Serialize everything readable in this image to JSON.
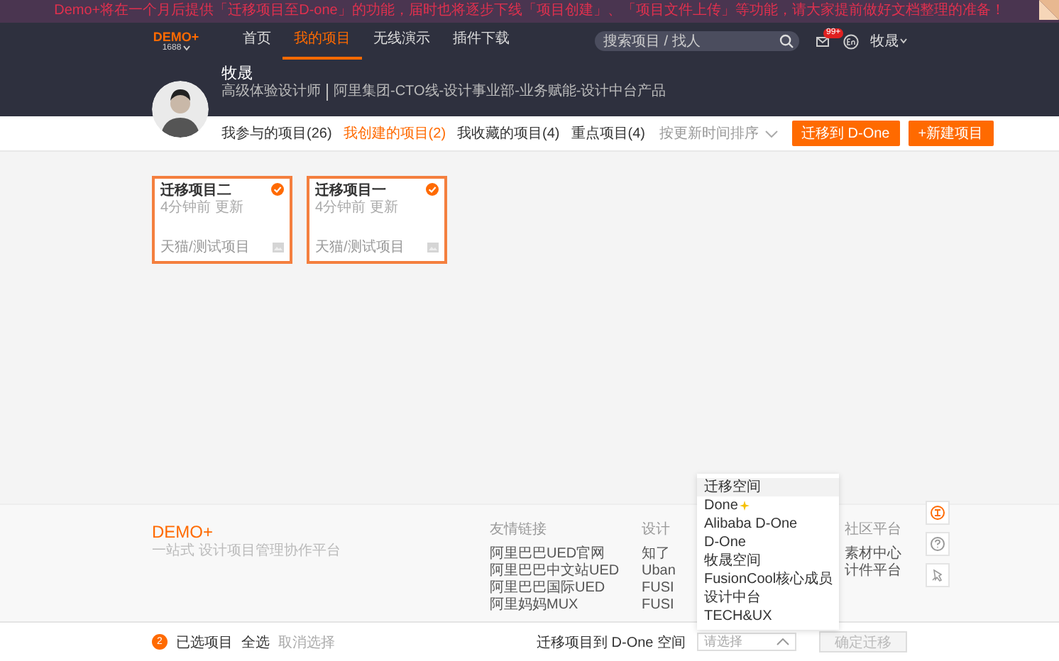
{
  "banner": {
    "text": "Demo+将在一个月后提供「迁移项目至D-one」的功能，届时也将逐步下线「项目创建」、「项目文件上传」等功能，请大家提前做好文档整理的准备！"
  },
  "header": {
    "logo": "DEMO+",
    "org": "1688",
    "nav": [
      {
        "label": "首页",
        "selected": false
      },
      {
        "label": "我的项目",
        "selected": true
      },
      {
        "label": "无线演示",
        "selected": false
      },
      {
        "label": "插件下载",
        "selected": false
      }
    ],
    "search": {
      "placeholder": "搜索项目 / 找人"
    },
    "mail_badge": "99+",
    "user": "牧晟"
  },
  "profile": {
    "name": "牧晟",
    "title": "高级体验设计师",
    "department": "阿里集团-CTO线-设计事业部-业务赋能-设计中台产品"
  },
  "tabs": [
    {
      "label": "我参与的项目(26)",
      "selected": false
    },
    {
      "label": "我创建的项目(2)",
      "selected": true
    },
    {
      "label": "我收藏的项目(4)",
      "selected": false
    },
    {
      "label": "重点项目(4)",
      "selected": false
    }
  ],
  "sort": "按更新时间排序",
  "buttons": [
    {
      "label": "迁移到 D-One"
    },
    {
      "label": "+新建项目"
    }
  ],
  "projects": [
    {
      "title": "迁移项目二",
      "updated": "4分钟前 更新",
      "path": "天猫/测试项目",
      "selected": true
    },
    {
      "title": "迁移项目一",
      "updated": "4分钟前 更新",
      "path": "天猫/测试项目",
      "selected": true
    }
  ],
  "footer": {
    "logo": "DEMO+",
    "slogan": "一站式 设计项目管理协作平台",
    "columns": [
      {
        "title": "友情链接",
        "links": [
          "阿里巴巴UED官网",
          "阿里巴巴中文站UED",
          "阿里巴巴国际UED",
          "阿里妈妈MUX"
        ]
      },
      {
        "title": "设计",
        "links": [
          "知了",
          "Uban",
          "FUSI",
          "FUSI"
        ]
      },
      {
        "title": "社区平台",
        "links": [
          "素材中心",
          "计件平台"
        ]
      }
    ]
  },
  "dropdown": {
    "items": [
      {
        "label": "迁移空间",
        "kind": "plain",
        "selected": true
      },
      {
        "label": "Done",
        "kind": "new",
        "selected": false
      },
      {
        "label": "Alibaba D-One",
        "kind": "plain",
        "selected": false
      },
      {
        "label": "D-One",
        "kind": "plain",
        "selected": false
      },
      {
        "label": "牧晟空间",
        "kind": "plain",
        "selected": false
      },
      {
        "label": "FusionCool核心成员",
        "kind": "plain",
        "selected": false
      },
      {
        "label": "设计中台",
        "kind": "plain",
        "selected": false
      },
      {
        "label": "TECH&UX",
        "kind": "plain",
        "selected": false
      }
    ]
  },
  "bottom_bar": {
    "count": "2",
    "selected_label": "已选项目",
    "select_all": "全选",
    "deselect": "取消选择",
    "target_label": "迁移项目到 D-One 空间",
    "select_placeholder": "请选择",
    "confirm": {
      "label": "确定迁移",
      "disabled": true
    }
  }
}
